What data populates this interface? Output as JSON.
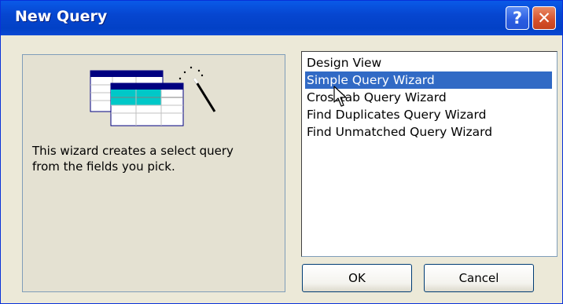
{
  "window": {
    "title": "New Query",
    "help_glyph": "?",
    "close_glyph": "✕"
  },
  "description": {
    "line1": "This wizard creates a select query",
    "line2": "from the fields you pick."
  },
  "list": {
    "items": [
      {
        "label": "Design View"
      },
      {
        "label": "Simple Query Wizard"
      },
      {
        "label": "Crosstab Query Wizard"
      },
      {
        "label": "Find Duplicates Query Wizard"
      },
      {
        "label": "Find Unmatched Query Wizard"
      }
    ],
    "selected_index": 1
  },
  "buttons": {
    "ok": "OK",
    "cancel": "Cancel"
  },
  "colors": {
    "title_bar": "#0a4fd8",
    "selection": "#316ac5",
    "dialog_bg": "#ece9d8"
  },
  "icons": {
    "illustration": "query-wizard-icon",
    "cursor": "mouse-cursor-icon"
  }
}
